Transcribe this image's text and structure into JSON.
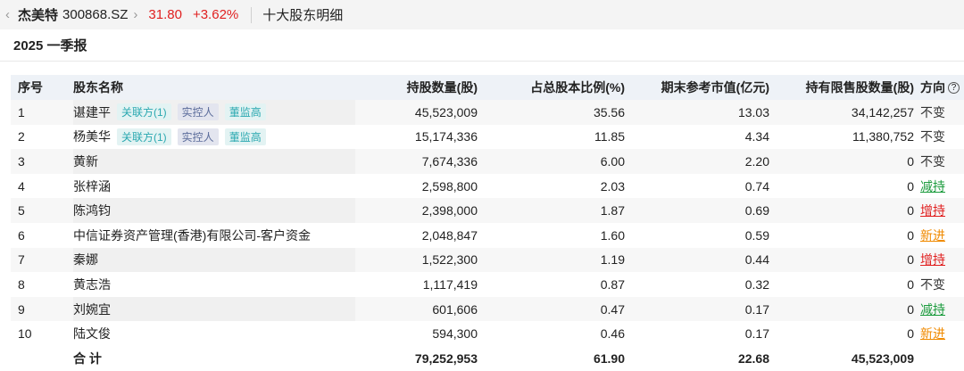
{
  "topbar": {
    "name": "杰美特",
    "code": "300868.SZ",
    "price": "31.80",
    "change": "+3.62%",
    "section": "十大股东明细"
  },
  "period": "2025 一季报",
  "headers": {
    "idx": "序号",
    "name": "股东名称",
    "shares": "持股数量(股)",
    "ratio": "占总股本比例(%)",
    "value": "期末参考市值(亿元)",
    "restricted": "持有限售股数量(股)",
    "dir": "方向"
  },
  "rows": [
    {
      "idx": "1",
      "name": "谌建平",
      "tags": [
        "关联方(1)",
        "实控人",
        "董监高"
      ],
      "shares": "45,523,009",
      "ratio": "35.56",
      "value": "13.03",
      "restricted": "34,142,257",
      "dir": "不变",
      "dir_type": "same"
    },
    {
      "idx": "2",
      "name": "杨美华",
      "tags": [
        "关联方(1)",
        "实控人",
        "董监高"
      ],
      "shares": "15,174,336",
      "ratio": "11.85",
      "value": "4.34",
      "restricted": "11,380,752",
      "dir": "不变",
      "dir_type": "same"
    },
    {
      "idx": "3",
      "name": "黄新",
      "tags": [],
      "shares": "7,674,336",
      "ratio": "6.00",
      "value": "2.20",
      "restricted": "0",
      "dir": "不变",
      "dir_type": "same"
    },
    {
      "idx": "4",
      "name": "张梓涵",
      "tags": [],
      "shares": "2,598,800",
      "ratio": "2.03",
      "value": "0.74",
      "restricted": "0",
      "dir": "减持",
      "dir_type": "down"
    },
    {
      "idx": "5",
      "name": "陈鸿钧",
      "tags": [],
      "shares": "2,398,000",
      "ratio": "1.87",
      "value": "0.69",
      "restricted": "0",
      "dir": "增持",
      "dir_type": "up"
    },
    {
      "idx": "6",
      "name": "中信证券资产管理(香港)有限公司-客户资金",
      "tags": [],
      "shares": "2,048,847",
      "ratio": "1.60",
      "value": "0.59",
      "restricted": "0",
      "dir": "新进",
      "dir_type": "new"
    },
    {
      "idx": "7",
      "name": "秦娜",
      "tags": [],
      "shares": "1,522,300",
      "ratio": "1.19",
      "value": "0.44",
      "restricted": "0",
      "dir": "增持",
      "dir_type": "up"
    },
    {
      "idx": "8",
      "name": "黄志浩",
      "tags": [],
      "shares": "1,117,419",
      "ratio": "0.87",
      "value": "0.32",
      "restricted": "0",
      "dir": "不变",
      "dir_type": "same"
    },
    {
      "idx": "9",
      "name": "刘婉宜",
      "tags": [],
      "shares": "601,606",
      "ratio": "0.47",
      "value": "0.17",
      "restricted": "0",
      "dir": "减持",
      "dir_type": "down"
    },
    {
      "idx": "10",
      "name": "陆文俊",
      "tags": [],
      "shares": "594,300",
      "ratio": "0.46",
      "value": "0.17",
      "restricted": "0",
      "dir": "新进",
      "dir_type": "new"
    }
  ],
  "total": {
    "label": "合 计",
    "shares": "79,252,953",
    "ratio": "61.90",
    "value": "22.68",
    "restricted": "45,523,009"
  },
  "colors": {
    "up": "#e02020",
    "down": "#1a9b3c",
    "new": "#f08a00",
    "tag_teal": "#2aa8b0",
    "tag_slate": "#5a6b9a"
  }
}
